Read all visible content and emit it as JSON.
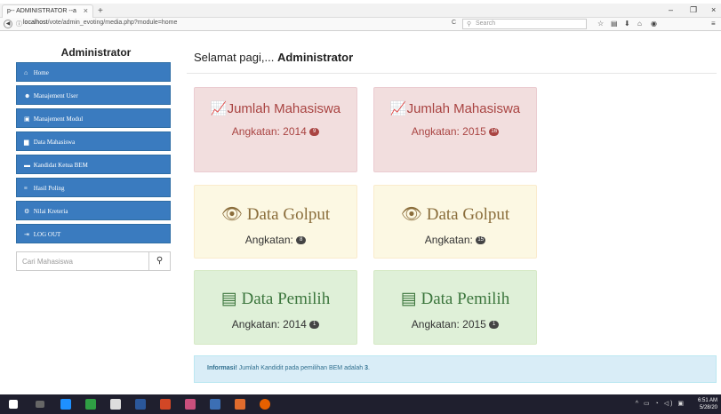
{
  "browser": {
    "tab_title": "p-- ADMINISTRATOR --a",
    "tab_close": "×",
    "new_tab": "+",
    "url_host": "localhost",
    "url_path": "/vote/admin_evoting/media.php?module=home",
    "search_placeholder": "Search",
    "win_min": "–",
    "win_max": "❐",
    "win_close": "×"
  },
  "sidebar": {
    "title": "Administrator",
    "items": [
      {
        "label": "Home",
        "icon": "home-icon"
      },
      {
        "label": "Manajement User",
        "icon": "users-icon"
      },
      {
        "label": "Manajement Modul",
        "icon": "modules-icon"
      },
      {
        "label": "Data Mahasiswa",
        "icon": "book-icon"
      },
      {
        "label": "Kandidat Ketua BEM",
        "icon": "card-icon"
      },
      {
        "label": "Hasil Poling",
        "icon": "list-icon"
      },
      {
        "label": "Nilai Kreteria",
        "icon": "gear-icon"
      },
      {
        "label": "LOG OUT",
        "icon": "logout-icon"
      }
    ],
    "search_placeholder": "Cari Mahasiswa"
  },
  "main": {
    "greeting_prefix": "Selamat pagi,...",
    "greeting_user": "Administrator",
    "cards": [
      {
        "title": "Jumlah Mahasiswa",
        "label": "Angkatan: 2014",
        "badge": "9"
      },
      {
        "title": "Jumlah Mahasiswa",
        "label": "Angkatan: 2015",
        "badge": "16"
      },
      {
        "title": "Data Golput",
        "label": "Angkatan:",
        "badge": "8"
      },
      {
        "title": "Data Golput",
        "label": "Angkatan:",
        "badge": "15"
      },
      {
        "title": "Data Pemilih",
        "label": "Angkatan: 2014",
        "badge": "1"
      },
      {
        "title": "Data Pemilih",
        "label": "Angkatan: 2015",
        "badge": "1"
      }
    ],
    "info_strong": "Informasi!",
    "info_text": "Jumlah Kandidit pada pemilihan BEM adalah",
    "info_count": "3",
    "info_end": "."
  },
  "taskbar": {
    "time": "6:51 AM",
    "date": "5/28/20"
  }
}
